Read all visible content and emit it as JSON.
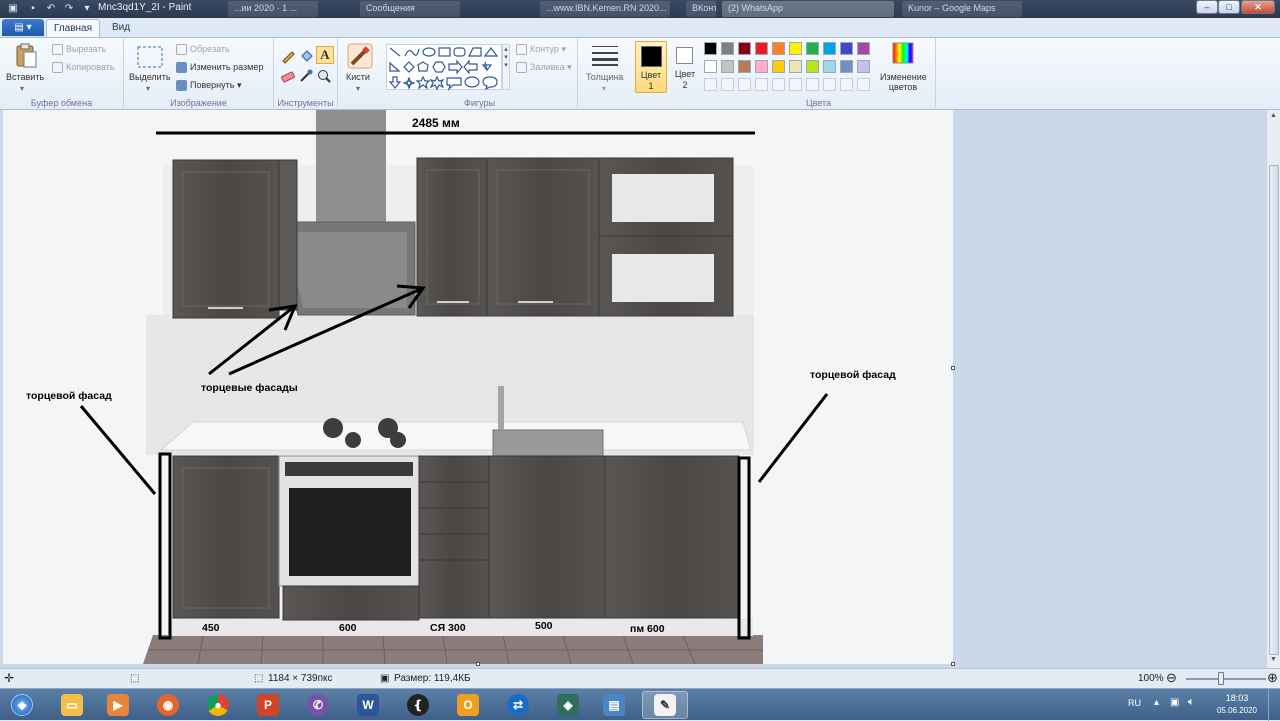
{
  "window": {
    "title": "Mnc3qd1Y_2I - Paint",
    "background_tabs": [
      "...ии 2020 · 1 ...",
      "Сообщения",
      "...www.IBN.Kemen.RN 2020...",
      "ВКонтакте",
      "(2) WhatsApp",
      "Kunor – Google Maps"
    ],
    "controls": {
      "minimize": "–",
      "maximize": "□",
      "close": "✕"
    }
  },
  "tabs": {
    "file_menu": "▤ ▾",
    "home": "Главная",
    "view": "Вид"
  },
  "ribbon": {
    "clipboard": {
      "label": "Буфер обмена",
      "paste": "Вставить",
      "cut": "Вырезать",
      "copy": "Копировать"
    },
    "image": {
      "label": "Изображение",
      "select": "Выделить",
      "crop": "Обрезать",
      "resize": "Изменить размер",
      "rotate": "Повернуть"
    },
    "tools": {
      "label": "Инструменты",
      "brushes": "Кисти"
    },
    "shapes": {
      "label": "Фигуры",
      "outline": "Контур",
      "fill": "Заливка"
    },
    "thickness": "Толщина",
    "color1": {
      "line1": "Цвет",
      "line2": "1"
    },
    "color2": {
      "line1": "Цвет",
      "line2": "2"
    },
    "colors": {
      "label": "Цвета",
      "edit_line1": "Изменение",
      "edit_line2": "цветов",
      "palette_row1": [
        "#000000",
        "#7f7f7f",
        "#880015",
        "#ed1c24",
        "#ff7f27",
        "#fff200",
        "#22b14c",
        "#00a2e8",
        "#3f48cc",
        "#a349a4"
      ],
      "palette_row2": [
        "#ffffff",
        "#c3c3c3",
        "#b97a57",
        "#ffaec9",
        "#ffc90e",
        "#efe4b0",
        "#b5e61d",
        "#99d9ea",
        "#7092be",
        "#c8bfe7"
      ]
    }
  },
  "drawing": {
    "dimension": "2485 мм",
    "label_end_left": "торцевой фасад",
    "label_end_right": "торцевой фасад",
    "label_end_upper": "торцевые фасады",
    "module_widths": [
      "450",
      "600",
      "СЯ 300",
      "500",
      "пм 600"
    ]
  },
  "status": {
    "image_size": "1184 × 739пкс",
    "file_size": "Размер: 119,4КБ",
    "zoom": "100%"
  },
  "taskbar": {
    "language": "RU",
    "time": "18:03",
    "date": "05.06.2020"
  }
}
